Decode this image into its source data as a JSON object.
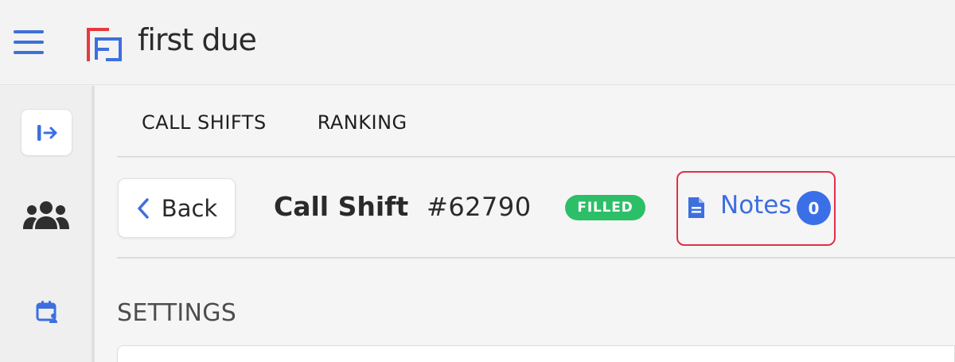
{
  "header": {
    "logo_text": "first due",
    "menu_icon": "hamburger-icon",
    "accent_color": "#3f6fd8"
  },
  "sidenav": {
    "items": [
      {
        "icon": "sign-in-arrow-icon"
      },
      {
        "icon": "people-group-icon"
      },
      {
        "icon": "calendar-user-icon"
      }
    ]
  },
  "tabs": [
    {
      "label": "CALL SHIFTS"
    },
    {
      "label": "RANKING"
    }
  ],
  "shift": {
    "back_label": "Back",
    "title": "Call Shift",
    "id": "#62790",
    "status": "FILLED",
    "status_color": "#2dbe68",
    "notes_label": "Notes",
    "notes_count": "0",
    "highlight_color": "#e0304a"
  },
  "settings": {
    "section_title": "SETTINGS"
  }
}
